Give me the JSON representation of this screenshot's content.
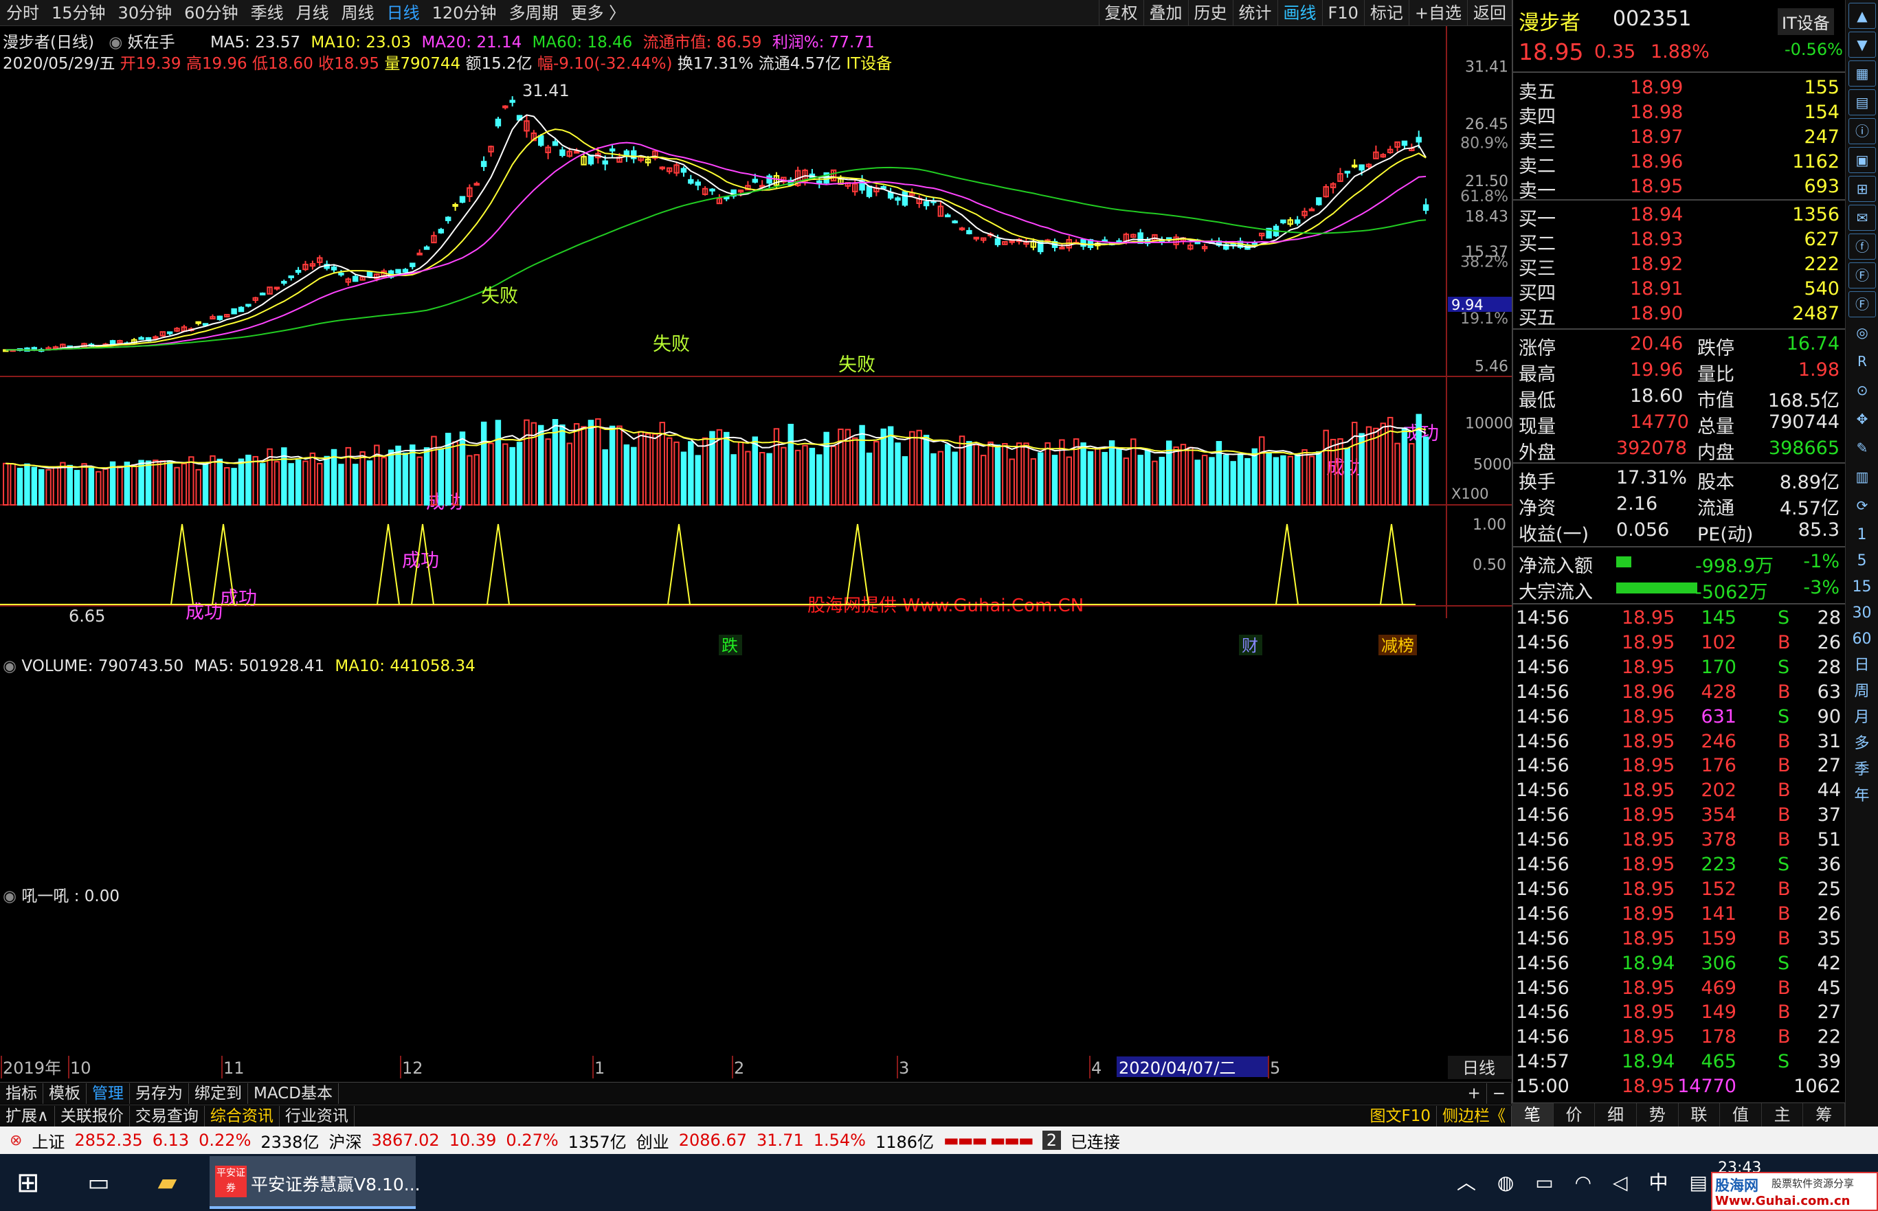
{
  "toolbar": {
    "periods": [
      "分时",
      "15分钟",
      "30分钟",
      "60分钟",
      "季线",
      "月线",
      "周线",
      "日线",
      "120分钟",
      "多周期",
      "更多 〉"
    ],
    "active_period": "日线",
    "right_tools": [
      "复权",
      "叠加",
      "历史",
      "统计",
      "画线",
      "F10",
      "标记",
      "+自选",
      "返回"
    ]
  },
  "chart_header": {
    "name": "漫步者(日线)",
    "formula": "妖在手",
    "ma5": "MA5: 23.57",
    "ma10": "MA10: 23.03",
    "ma20": "MA20: 21.14",
    "ma60": "MA60: 18.46",
    "mktcap": "流通市值: 86.59",
    "profit": "利润%: 77.71"
  },
  "info_line": {
    "date": "2020/05/29/五",
    "open": "开19.39",
    "high": "高19.96",
    "low": "低18.60",
    "close": "收18.95",
    "vol": "量790744",
    "amount": "额15.2亿",
    "change": "幅-9.10(-32.44%)",
    "turnover": "换17.31%",
    "float": "流通4.57亿",
    "sector": "IT设备"
  },
  "price_axis": {
    "labels": [
      "31.41",
      "26.45",
      "21.50",
      "18.43",
      "15.37",
      "5.46"
    ],
    "pct_labels": [
      "80.9%",
      "61.8%",
      "38.2%",
      "19.1%"
    ],
    "current": "9.94"
  },
  "annotations": {
    "max": "31.41",
    "min": "6.65",
    "success": "成功",
    "fail": "失败",
    "watermark": "股海网提供 Www.Guhai.Com.CN",
    "events": [
      "跌",
      "财",
      "减榜"
    ]
  },
  "volume": {
    "header": "VOLUME: 790743.50",
    "ma5": "MA5: 501928.41",
    "ma10": "MA10: 441058.34",
    "axis": [
      "10000",
      "5000"
    ],
    "unit": "X100"
  },
  "indicator": {
    "header": "吼一吼 : 0.00",
    "axis": [
      "1.00",
      "0.50"
    ]
  },
  "date_axis": {
    "labels": [
      "2019年",
      "10",
      "11",
      "12",
      "1",
      "2",
      "3",
      "4",
      "5"
    ],
    "selected": "2020/04/07/二",
    "period": "日线"
  },
  "bottom_toolbar": {
    "items": [
      "指标",
      "模板",
      "管理",
      "另存为",
      "绑定到",
      "MACD基本"
    ],
    "active": "管理"
  },
  "bottom_toolbar2": {
    "items": [
      "扩展∧",
      "关联报价",
      "交易查询",
      "综合资讯",
      "行业资讯"
    ],
    "active": "综合资讯",
    "right": [
      "图文F10",
      "侧边栏《"
    ]
  },
  "quote": {
    "name": "漫步者",
    "code": "002351",
    "sector": "IT设备",
    "sector_chg": "-0.56%",
    "price": "18.95",
    "chg": "0.35",
    "pct": "1.88%",
    "asks": [
      {
        "l": "卖五",
        "p": "18.99",
        "v": "155"
      },
      {
        "l": "卖四",
        "p": "18.98",
        "v": "154"
      },
      {
        "l": "卖三",
        "p": "18.97",
        "v": "247"
      },
      {
        "l": "卖二",
        "p": "18.96",
        "v": "1162"
      },
      {
        "l": "卖一",
        "p": "18.95",
        "v": "693"
      }
    ],
    "bids": [
      {
        "l": "买一",
        "p": "18.94",
        "v": "1356"
      },
      {
        "l": "买二",
        "p": "18.93",
        "v": "627"
      },
      {
        "l": "买三",
        "p": "18.92",
        "v": "222"
      },
      {
        "l": "买四",
        "p": "18.91",
        "v": "540"
      },
      {
        "l": "买五",
        "p": "18.90",
        "v": "2487"
      }
    ],
    "stats": [
      [
        "涨停",
        "20.46",
        "跌停",
        "16.74"
      ],
      [
        "最高",
        "19.96",
        "量比",
        "1.98"
      ],
      [
        "最低",
        "18.60",
        "市值",
        "168.5亿"
      ],
      [
        "现量",
        "14770",
        "总量",
        "790744"
      ],
      [
        "外盘",
        "392078",
        "内盘",
        "398665"
      ]
    ],
    "stats2": [
      [
        "换手",
        "17.31%",
        "股本",
        "8.89亿"
      ],
      [
        "净资",
        "2.16",
        "流通",
        "4.57亿"
      ],
      [
        "收益(一)",
        "0.056",
        "PE(动)",
        "85.3"
      ]
    ],
    "flow": [
      [
        "净流入额",
        "-998.9万",
        "-1%"
      ],
      [
        "大宗流入",
        "-5062万",
        "-3%"
      ]
    ]
  },
  "ticks": [
    [
      "14:56",
      "18.95",
      "145",
      "S",
      "28"
    ],
    [
      "14:56",
      "18.95",
      "102",
      "B",
      "26"
    ],
    [
      "14:56",
      "18.95",
      "170",
      "S",
      "28"
    ],
    [
      "14:56",
      "18.96",
      "428",
      "B",
      "63"
    ],
    [
      "14:56",
      "18.95",
      "631",
      "S",
      "90"
    ],
    [
      "14:56",
      "18.95",
      "246",
      "B",
      "31"
    ],
    [
      "14:56",
      "18.95",
      "176",
      "B",
      "27"
    ],
    [
      "14:56",
      "18.95",
      "202",
      "B",
      "44"
    ],
    [
      "14:56",
      "18.95",
      "354",
      "B",
      "37"
    ],
    [
      "14:56",
      "18.95",
      "378",
      "B",
      "51"
    ],
    [
      "14:56",
      "18.95",
      "223",
      "S",
      "36"
    ],
    [
      "14:56",
      "18.95",
      "152",
      "B",
      "25"
    ],
    [
      "14:56",
      "18.95",
      "141",
      "B",
      "26"
    ],
    [
      "14:56",
      "18.95",
      "159",
      "B",
      "35"
    ],
    [
      "14:56",
      "18.94",
      "306",
      "S",
      "42"
    ],
    [
      "14:56",
      "18.95",
      "469",
      "B",
      "45"
    ],
    [
      "14:56",
      "18.95",
      "149",
      "B",
      "27"
    ],
    [
      "14:56",
      "18.95",
      "178",
      "B",
      "22"
    ],
    [
      "14:57",
      "18.94",
      "465",
      "S",
      "39"
    ],
    [
      "15:00",
      "18.95",
      "14770",
      "",
      "1062"
    ]
  ],
  "right_tabs": [
    "笔",
    "价",
    "细",
    "势",
    "联",
    "值",
    "主",
    "筹"
  ],
  "ticker": {
    "sh_name": "上证",
    "sh": "2852.35",
    "sh_chg": "6.13",
    "sh_pct": "0.22%",
    "sh_amt": "2338亿",
    "sz_name": "沪深",
    "sz": "3867.02",
    "sz_chg": "10.39",
    "sz_pct": "0.27%",
    "sz_amt": "1357亿",
    "cy_name": "创业",
    "cy": "2086.67",
    "cy_chg": "31.71",
    "cy_pct": "1.54%",
    "cy_amt": "1186亿",
    "conn": "已连接"
  },
  "taskbar": {
    "app": "平安证券慧赢V8.10...",
    "app_icon": "平安证券",
    "ime": "中",
    "time": "23:43",
    "brand": "股海网",
    "brand_sub": "股票软件资源分享",
    "brand_url": "Www.Guhai.com.cn"
  },
  "icons": [
    "arrow-up-icon",
    "arrow-down-icon",
    "chart-icon",
    "list-icon",
    "info-icon",
    "news-icon",
    "f10-icon",
    "mail-icon",
    "f-icon",
    "f2-icon",
    "f3-icon",
    "circle-icon",
    "rsi-icon",
    "target-icon",
    "move-icon",
    "pen-icon",
    "calc-icon",
    "refresh-icon"
  ],
  "iconbar_labels": [
    "1",
    "5",
    "15",
    "30",
    "60",
    "日",
    "周",
    "月",
    "多",
    "季",
    "年"
  ],
  "colors": {
    "up": "#ff3a3a",
    "down": "#44ffff",
    "ma5": "#ffffff",
    "ma10": "#ffff33",
    "ma20": "#ff44ff",
    "ma60": "#22cc22"
  }
}
